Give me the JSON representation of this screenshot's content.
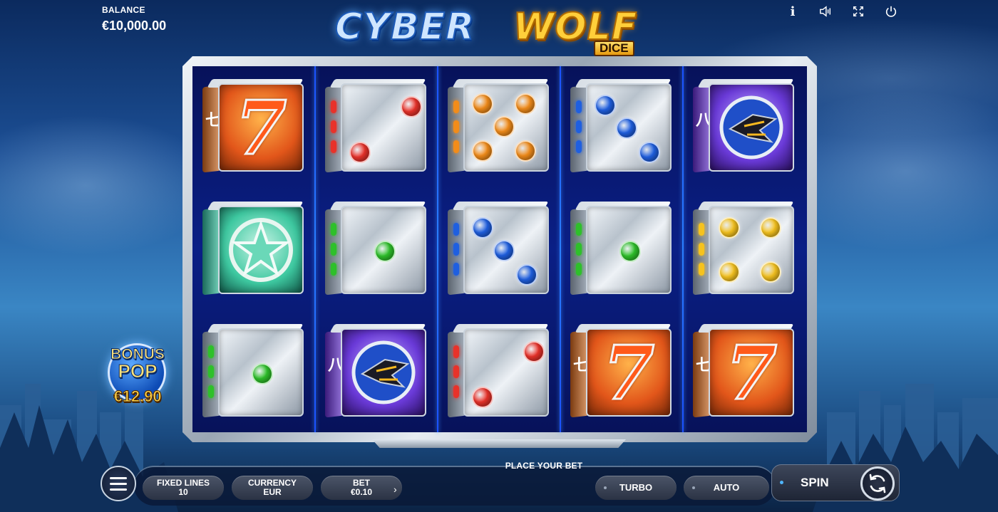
{
  "balance": {
    "label": "BALANCE",
    "value": "€10,000.00"
  },
  "logo": {
    "word1": "CYBER",
    "word2": "WOLF",
    "subtitle": "DICE"
  },
  "top_icons": [
    "info-icon",
    "sound-icon",
    "fullscreen-icon",
    "power-icon"
  ],
  "top_icon_glyphs": {
    "info": "i"
  },
  "bonus_pop": {
    "line1": "BONUS",
    "line2": "POP",
    "amount": "€12.90"
  },
  "grid": {
    "rows": 3,
    "columns": 5,
    "cells": [
      [
        "seven",
        "dice-2-red",
        "dice-5-orange",
        "dice-3-blue",
        "ship-purple"
      ],
      [
        "star-green",
        "dice-1-green",
        "dice-3-blue",
        "dice-1-green",
        "dice-4-yellow"
      ],
      [
        "dice-1-green",
        "ship-purple",
        "dice-2-red",
        "seven",
        "seven"
      ]
    ]
  },
  "symbol_text": {
    "seven": "7",
    "side_seven": "七",
    "side_eight": "八"
  },
  "colors": {
    "red": "#e8322a",
    "orange": "#f28c1a",
    "blue": "#1f5fe0",
    "green": "#2ec02a",
    "yellow": "#f5c21e",
    "purple": "#7a3ae0",
    "teal": "#3ec8a0"
  },
  "controls": {
    "place_your_bet": "PLACE YOUR BET",
    "fixed_lines": {
      "label": "FIXED LINES",
      "value": "10"
    },
    "currency": {
      "label": "CURRENCY",
      "value": "EUR"
    },
    "bet": {
      "label": "BET",
      "value": "€0.10"
    },
    "turbo": "TURBO",
    "auto": "AUTO",
    "spin": "SPIN",
    "bet_arrow": "›"
  }
}
